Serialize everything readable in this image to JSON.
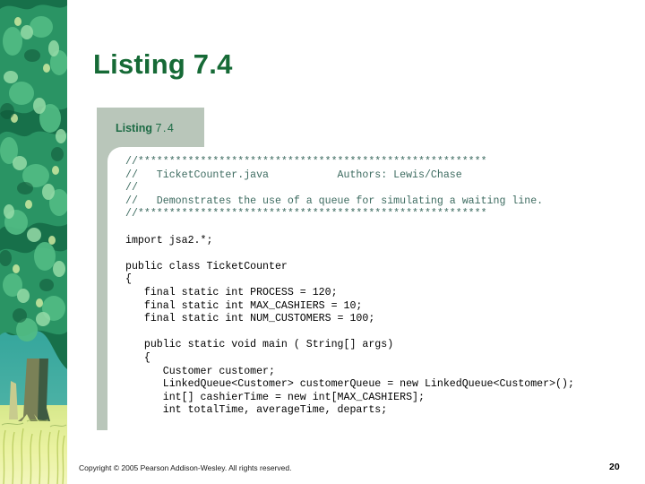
{
  "slide": {
    "title": "Listing 7.4",
    "title_color": "#166a36",
    "background_color": "#ffffff"
  },
  "decoration": {
    "left_image": "tree-illustration",
    "description": "green leafy tree with trunk over yellow-green grass",
    "colors": {
      "foliage_dark": "#176b47",
      "foliage_mid": "#2f9b66",
      "foliage_light": "#7fd49a",
      "highlight": "#cfe9a8",
      "trunk": "#6f7a55",
      "grass": "#e9ef8a",
      "sky": "#3aa6a0"
    }
  },
  "listing": {
    "tab_label_strong": "Listing",
    "tab_label_number": "7.4",
    "tab_text_color": "#1d6b45",
    "band_color": "#b9c6ba",
    "comment_color": "#3d6b60",
    "code_color": "#000000",
    "language": "java",
    "code_lines": [
      {
        "text": "//********************************************************",
        "type": "comment"
      },
      {
        "text": "//   TicketCounter.java           Authors: Lewis/Chase",
        "type": "comment"
      },
      {
        "text": "//",
        "type": "comment"
      },
      {
        "text": "//   Demonstrates the use of a queue for simulating a waiting line.",
        "type": "comment"
      },
      {
        "text": "//********************************************************",
        "type": "comment"
      },
      {
        "text": "",
        "type": "blank"
      },
      {
        "text": "import jsa2.*;",
        "type": "code"
      },
      {
        "text": "",
        "type": "blank"
      },
      {
        "text": "public class TicketCounter",
        "type": "code"
      },
      {
        "text": "{",
        "type": "code"
      },
      {
        "text": "   final static int PROCESS = 120;",
        "type": "code"
      },
      {
        "text": "   final static int MAX_CASHIERS = 10;",
        "type": "code"
      },
      {
        "text": "   final static int NUM_CUSTOMERS = 100;",
        "type": "code"
      },
      {
        "text": "",
        "type": "blank"
      },
      {
        "text": "   public static void main ( String[] args)",
        "type": "code"
      },
      {
        "text": "   {",
        "type": "code"
      },
      {
        "text": "      Customer customer;",
        "type": "code"
      },
      {
        "text": "      LinkedQueue<Customer> customerQueue = new LinkedQueue<Customer>();",
        "type": "code"
      },
      {
        "text": "      int[] cashierTime = new int[MAX_CASHIERS];",
        "type": "code"
      },
      {
        "text": "      int totalTime, averageTime, departs;",
        "type": "code"
      }
    ]
  },
  "footer": {
    "copyright": "Copyright © 2005 Pearson Addison-Wesley. All rights reserved.",
    "page_number": "20"
  }
}
